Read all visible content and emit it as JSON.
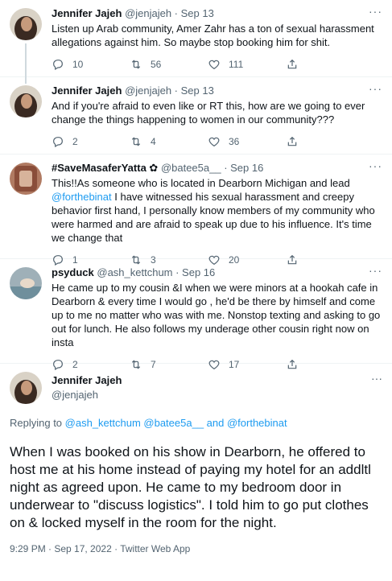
{
  "tweets": [
    {
      "name": "Jennifer Jajeh",
      "meta": "@jenjajeh · Sep 13",
      "text": "Listen up Arab community, Amer Zahr has a ton of sexual harassment allegations against him. So maybe stop booking him for shit.",
      "replies": "10",
      "retweets": "56",
      "likes": "111"
    },
    {
      "name": "Jennifer Jajeh",
      "meta": "@jenjajeh · Sep 13",
      "text": "And if you're afraid to even like or RT  this, how are we going to ever change the things happening to women in our community???",
      "replies": "2",
      "retweets": "4",
      "likes": "36"
    },
    {
      "name": "#SaveMasaferYatta ✿",
      "meta": "@batee5a__ · Sep 16",
      "text_pre": "This!!As someone who is located in Dearborn Michigan and lead ",
      "mention": "@forthebinat",
      "text_post": " I have witnessed his sexual harassment and creepy behavior first hand, I personally know members of my community who were harmed and are afraid to speak up due to his influence. It's time we change that",
      "replies": "1",
      "retweets": "3",
      "likes": "20"
    },
    {
      "name": "psyduck",
      "meta": "@ash_kettchum · Sep 16",
      "text": "He came up to my cousin &I when we were minors at a hookah cafe in Dearborn & every time I would go , he'd be there by himself and come up to me no matter who was with me. Nonstop texting and asking to go out for lunch.  He also follows my underage other cousin right now on insta",
      "replies": "2",
      "retweets": "7",
      "likes": "17"
    }
  ],
  "main": {
    "name": "Jennifer Jajeh",
    "handle": "@jenjajeh",
    "replying_prefix": "Replying to ",
    "replying_mentions": "@ash_kettchum @batee5a__ and @forthebinat",
    "text": "When I was booked on his show in Dearborn, he offered to host me at his home instead of paying my hotel for an addltl night as agreed upon. He came to my bedroom door in underwear to \"discuss logistics\". I told him to go put clothes on & locked myself in the room for the night.",
    "timestamp": "9:29 PM · Sep 17, 2022 · Twitter Web App"
  },
  "more_glyph": "···",
  "icons": [
    "reply-icon",
    "retweet-icon",
    "like-icon",
    "share-icon",
    "more-icon"
  ],
  "colors": {
    "accent": "#1d9bf0",
    "secondary_text": "#536471",
    "border": "#eff3f4"
  }
}
